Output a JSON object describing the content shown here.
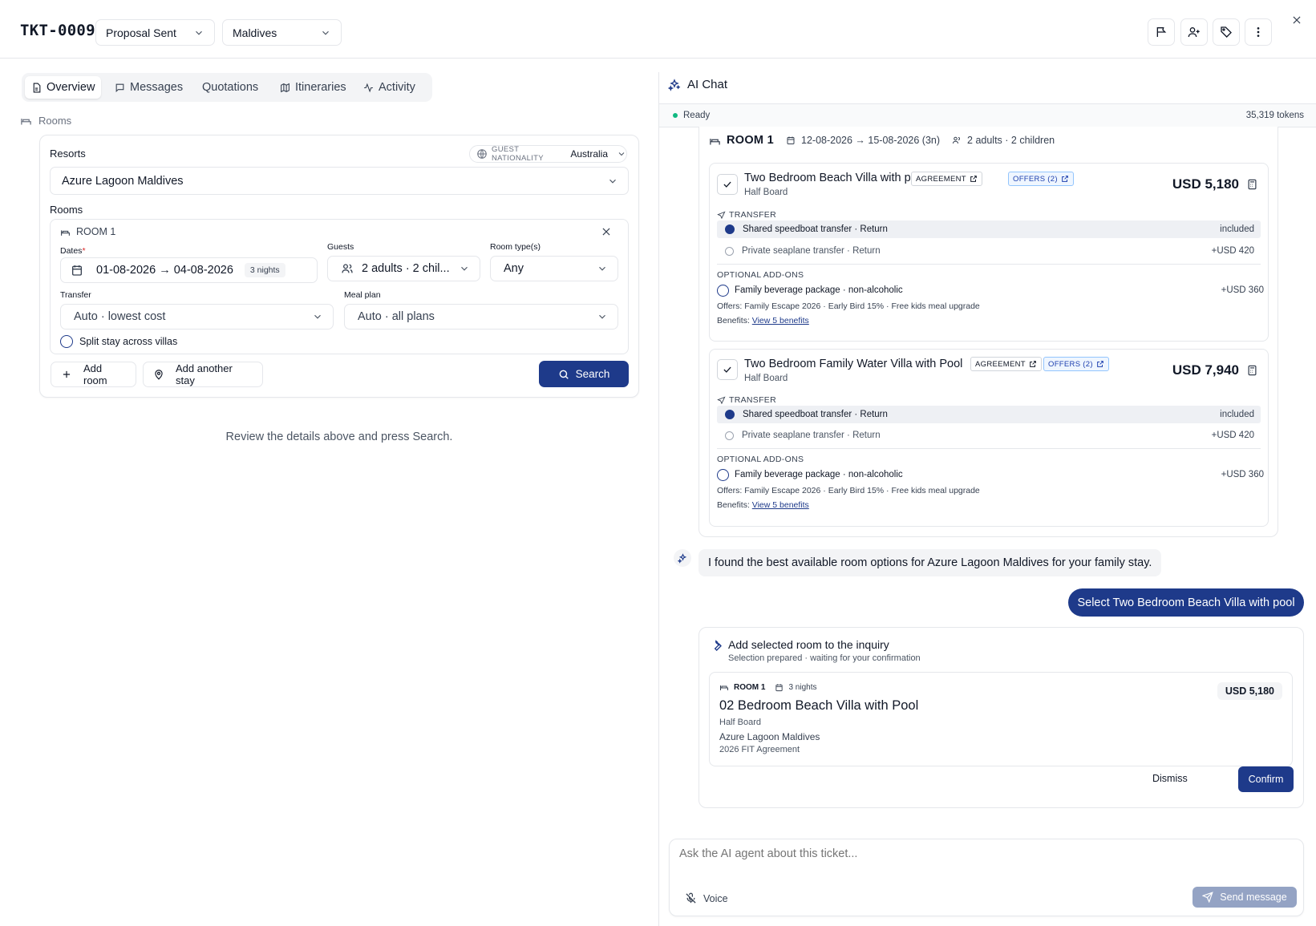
{
  "header": {
    "ticket_id": "TKT-0009",
    "status_select": "Proposal Sent",
    "destination_select": "Maldives"
  },
  "tabs": [
    {
      "label": "Overview",
      "icon": "document-icon",
      "active": true
    },
    {
      "label": "Messages",
      "icon": "message-icon",
      "active": false
    },
    {
      "label": "Quotations",
      "icon": "",
      "active": false
    },
    {
      "label": "Itineraries",
      "icon": "map-icon",
      "active": false
    },
    {
      "label": "Activity",
      "icon": "activity-icon",
      "active": false
    }
  ],
  "left": {
    "section_label": "Rooms",
    "resorts_label": "Resorts",
    "nationality_label": "GUEST NATIONALITY",
    "nationality_value": "Australia",
    "resort_value": "Azure Lagoon Maldives",
    "rooms_label": "Rooms",
    "room": {
      "title": "ROOM 1",
      "dates_label": "Dates",
      "required_mark": "*",
      "dates_value": "01-08-2026 → 04-08-2026",
      "nights": "3 nights",
      "guests_label": "Guests",
      "guests_value": "2 adults · 2 chil...",
      "room_type_label": "Room type(s)",
      "room_type_value": "Any",
      "transfer_label": "Transfer",
      "transfer_value": "Auto · lowest cost",
      "meal_label": "Meal plan",
      "meal_value": "Auto · all plans",
      "split_label": "Split stay across villas"
    },
    "add_room_label": "Add room",
    "add_stay_label": "Add another stay",
    "search_label": "Search",
    "review_text": "Review the details above and press Search."
  },
  "chat": {
    "title": "AI Chat",
    "status": "Ready",
    "tokens": "35,319 tokens",
    "result_header": {
      "room": "ROOM 1",
      "dates": "12-08-2026 → 15-08-2026 (3n)",
      "guests": "2 adults · 2 children"
    },
    "options": [
      {
        "title": "Two Bedroom Beach Villa with pool",
        "board": "Half Board",
        "agreement_tag": "AGREEMENT",
        "offers_tag": "OFFERS (2)",
        "price": "USD 5,180",
        "transfer_label": "TRANSFER",
        "transfers": [
          {
            "label": "Shared speedboat transfer · Return",
            "price": "included",
            "selected": true
          },
          {
            "label": "Private seaplane transfer · Return",
            "price": "+USD 420",
            "selected": false
          }
        ],
        "addons_label": "OPTIONAL ADD-ONS",
        "addon": {
          "label": "Family beverage package · non-alcoholic",
          "price": "+USD 360"
        },
        "offers_text": "Offers: Family Escape 2026 · Early Bird 15% · Free kids meal upgrade",
        "benefits_label": "Benefits:",
        "benefits_link": "View 5 benefits"
      },
      {
        "title": "Two Bedroom Family Water Villa with Pool",
        "board": "Half Board",
        "agreement_tag": "AGREEMENT",
        "offers_tag": "OFFERS (2)",
        "price": "USD 7,940",
        "transfer_label": "TRANSFER",
        "transfers": [
          {
            "label": "Shared speedboat transfer · Return",
            "price": "included",
            "selected": true
          },
          {
            "label": "Private seaplane transfer · Return",
            "price": "+USD 420",
            "selected": false
          }
        ],
        "addons_label": "OPTIONAL ADD-ONS",
        "addon": {
          "label": "Family beverage package · non-alcoholic",
          "price": "+USD 360"
        },
        "offers_text": "Offers: Family Escape 2026 · Early Bird 15% · Free kids meal upgrade",
        "benefits_label": "Benefits:",
        "benefits_link": "View 5 benefits"
      }
    ],
    "assistant_message": "I found the best available room options for Azure Lagoon Maldives for your family stay.",
    "user_message": "Select Two Bedroom Beach Villa with pool",
    "tool": {
      "title": "Add selected room to the inquiry",
      "subtitle": "Selection prepared · waiting for your confirmation",
      "room": "ROOM 1",
      "nights": "3 nights",
      "price": "USD 5,180",
      "room_name": "02 Bedroom Beach Villa with Pool",
      "board": "Half Board",
      "resort": "Azure Lagoon Maldives",
      "agreement": "2026 FIT Agreement",
      "dismiss": "Dismiss",
      "confirm": "Confirm"
    },
    "input_placeholder": "Ask the AI agent about this ticket...",
    "voice_label": "Voice",
    "send_label": "Send message"
  },
  "colors": {
    "primary": "#1e3a8a",
    "ready": "#10b981",
    "border": "#e5e7eb"
  }
}
